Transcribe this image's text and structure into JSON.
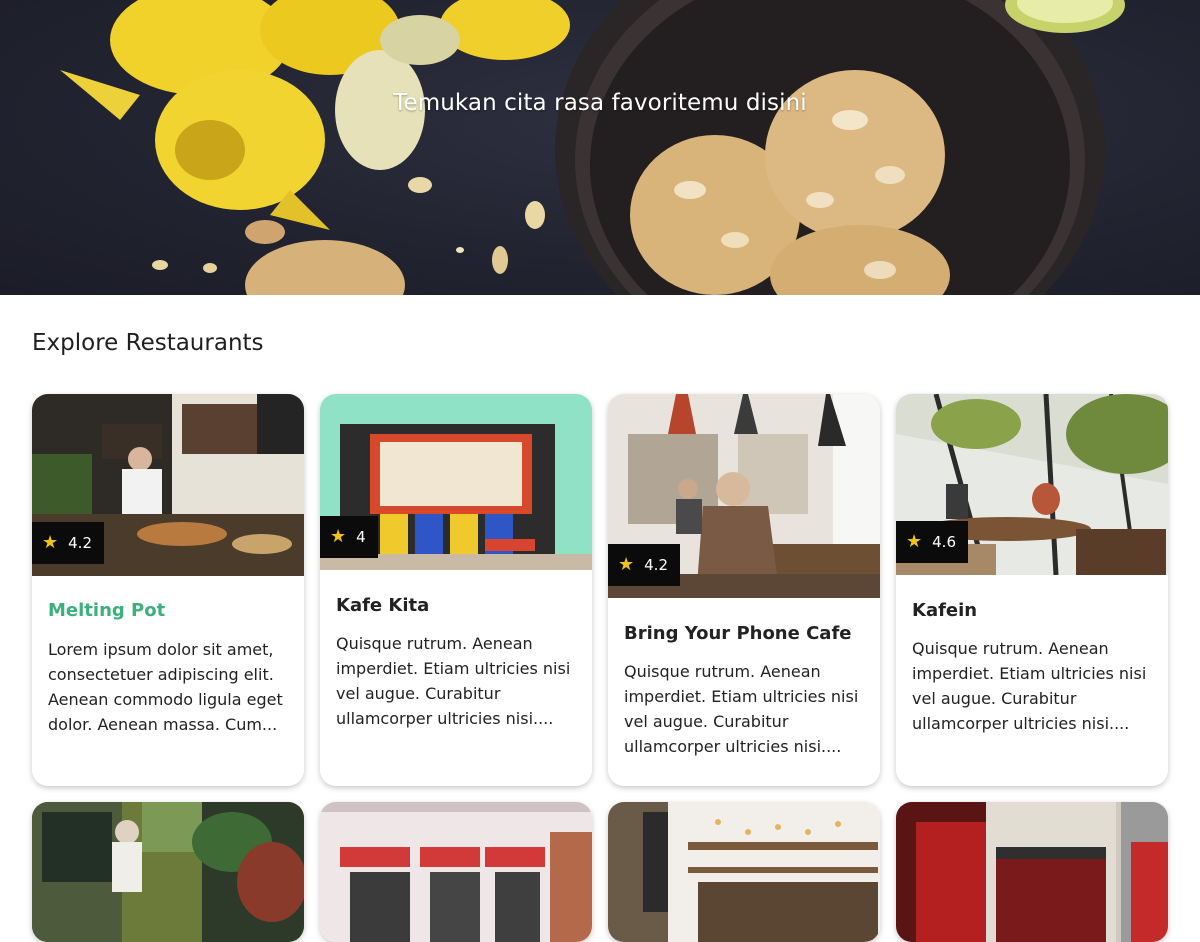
{
  "hero": {
    "tagline": "Temukan cita rasa favoritemu disini"
  },
  "colors": {
    "accent": "#3bb07a",
    "star": "#f1c31a",
    "badge_bg": "#0b0b0b"
  },
  "section": {
    "title": "Explore Restaurants"
  },
  "restaurants": [
    {
      "name": "Melting Pot",
      "rating": "4.2",
      "description": "Lorem ipsum dolor sit amet, consectetuer adipiscing elit. Aenean commodo ligula eget dolor. Aenean massa. Cum...",
      "highlighted": true
    },
    {
      "name": "Kafe Kita",
      "rating": "4",
      "description": "Quisque rutrum. Aenean imperdiet. Etiam ultricies nisi vel augue. Curabitur ullamcorper ultricies nisi....",
      "highlighted": false
    },
    {
      "name": "Bring Your Phone Cafe",
      "rating": "4.2",
      "description": "Quisque rutrum. Aenean imperdiet. Etiam ultricies nisi vel augue. Curabitur ullamcorper ultricies nisi....",
      "highlighted": false
    },
    {
      "name": "Kafein",
      "rating": "4.6",
      "description": "Quisque rutrum. Aenean imperdiet. Etiam ultricies nisi vel augue. Curabitur ullamcorper ultricies nisi....",
      "highlighted": false
    }
  ],
  "icons": {
    "rating": "star-icon"
  }
}
